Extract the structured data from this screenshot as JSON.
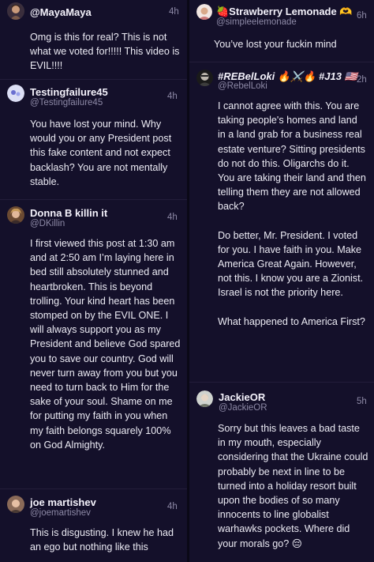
{
  "left_column": [
    {
      "display_name": "@MayaMaya",
      "handle": "",
      "time": "4h",
      "body": [
        "Omg is this for real? This is not what we voted for!!!!! This video is EVIL!!!!"
      ]
    },
    {
      "display_name": "Testingfailure45",
      "handle": "@Testingfailure45",
      "time": "4h",
      "body": [
        "You have lost your mind. Why would you or any President post this fake content and not expect backlash? You are not mentally stable."
      ]
    },
    {
      "display_name": "Donna B killin it",
      "handle": "@DKillin",
      "time": "4h",
      "body": [
        "I first viewed this post at 1:30 am and at 2:50 am I’m laying here in bed still absolutely stunned and heartbroken. This is beyond trolling. Your kind heart has been stomped on by the EVIL ONE. I will always support you as my President and believe God spared you to save our country. God will never turn away from you but you need to turn back to Him for the sake of your soul. Shame on me for putting my faith in you when my faith belongs squarely 100% on God Almighty."
      ]
    },
    {
      "display_name": "joe martishev",
      "handle": "@joemartishev",
      "time": "4h",
      "body": [
        "This is disgusting. I knew he had an ego but nothing like this"
      ]
    }
  ],
  "right_column": [
    {
      "display_name": "🍓Strawberry Lemonade 🫶",
      "handle": "@simpleelemonade",
      "time": "6h",
      "body": [
        "You’ve lost your fuckin mind"
      ]
    },
    {
      "display_name": "#REBelLoki 🔥⚔️🔥 #J13 🇺🇸",
      "handle": "@RebelLoki",
      "time": "2h",
      "body": [
        "I cannot agree with this. You are taking people's homes and land in a land grab for a business real estate venture? Sitting presidents do not do this. Oligarchs do it. You are taking their land and then telling them they are not allowed back?",
        "Do better, Mr. President. I voted for you. I have faith in you. Make America Great Again. However, not this. I know you are a Zionist. Israel is not the priority here.",
        "What happened to America First?"
      ]
    },
    {
      "display_name": "JackieOR",
      "handle": "@JackieOR",
      "time": "5h",
      "body": [
        "Sorry but this leaves a bad taste in my mouth, especially considering that the Ukraine could probably be next in line to be turned into a holiday resort built upon the bodies of so many innocents to line globalist warhawks pockets. Where did your morals go? 😔"
      ]
    }
  ],
  "colors": {
    "background": "#14102a",
    "separator": "#231d3a",
    "text": "#ecebf4",
    "muted": "#8d89a6"
  }
}
